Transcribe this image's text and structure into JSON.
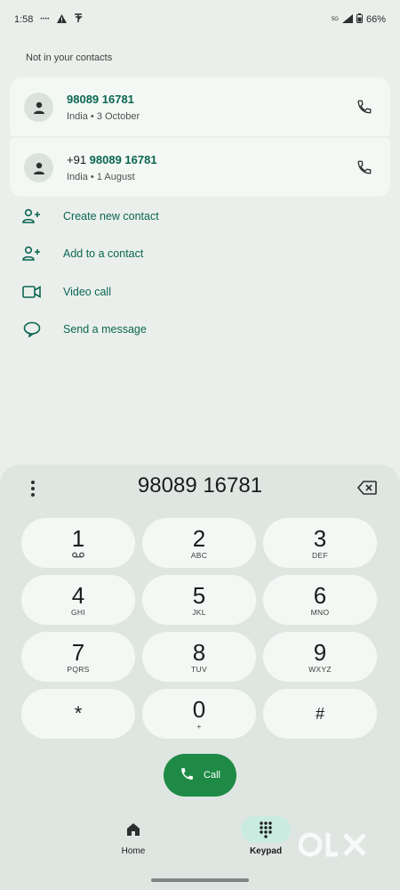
{
  "status": {
    "time": "1:58",
    "network_small": "••••",
    "signal_label": "5G",
    "battery": "66%"
  },
  "heading": "Not in your contacts",
  "entries": [
    {
      "number_plain": "",
      "number_bold": "98089 16781",
      "detail": "India • 3 October"
    },
    {
      "number_plain": "+91 ",
      "number_bold": "98089 16781",
      "detail": "India • 1 August"
    }
  ],
  "actions": [
    {
      "label": "Create new contact",
      "icon": "add-person-icon"
    },
    {
      "label": "Add to a contact",
      "icon": "add-person-icon"
    },
    {
      "label": "Video call",
      "icon": "video-camera-icon"
    },
    {
      "label": "Send a message",
      "icon": "message-bubble-icon"
    }
  ],
  "dialpad": {
    "entered_number": "98089 16781",
    "keys": [
      {
        "digit": "1",
        "letters": ""
      },
      {
        "digit": "2",
        "letters": "ABC"
      },
      {
        "digit": "3",
        "letters": "DEF"
      },
      {
        "digit": "4",
        "letters": "GHI"
      },
      {
        "digit": "5",
        "letters": "JKL"
      },
      {
        "digit": "6",
        "letters": "MNO"
      },
      {
        "digit": "7",
        "letters": "PQRS"
      },
      {
        "digit": "8",
        "letters": "TUV"
      },
      {
        "digit": "9",
        "letters": "WXYZ"
      },
      {
        "digit": "*",
        "letters": ""
      },
      {
        "digit": "0",
        "letters": "+"
      },
      {
        "digit": "#",
        "letters": ""
      }
    ],
    "call_label": "Call"
  },
  "nav": {
    "home_label": "Home",
    "keypad_label": "Keypad"
  },
  "watermark": "OLX",
  "colors": {
    "accent": "#0b6650",
    "call_green": "#1e8a46",
    "background": "#eaefec",
    "card": "#f3f8f5",
    "dialpad_bg": "#dfe6e2",
    "nav_active": "#c9ebe0"
  }
}
